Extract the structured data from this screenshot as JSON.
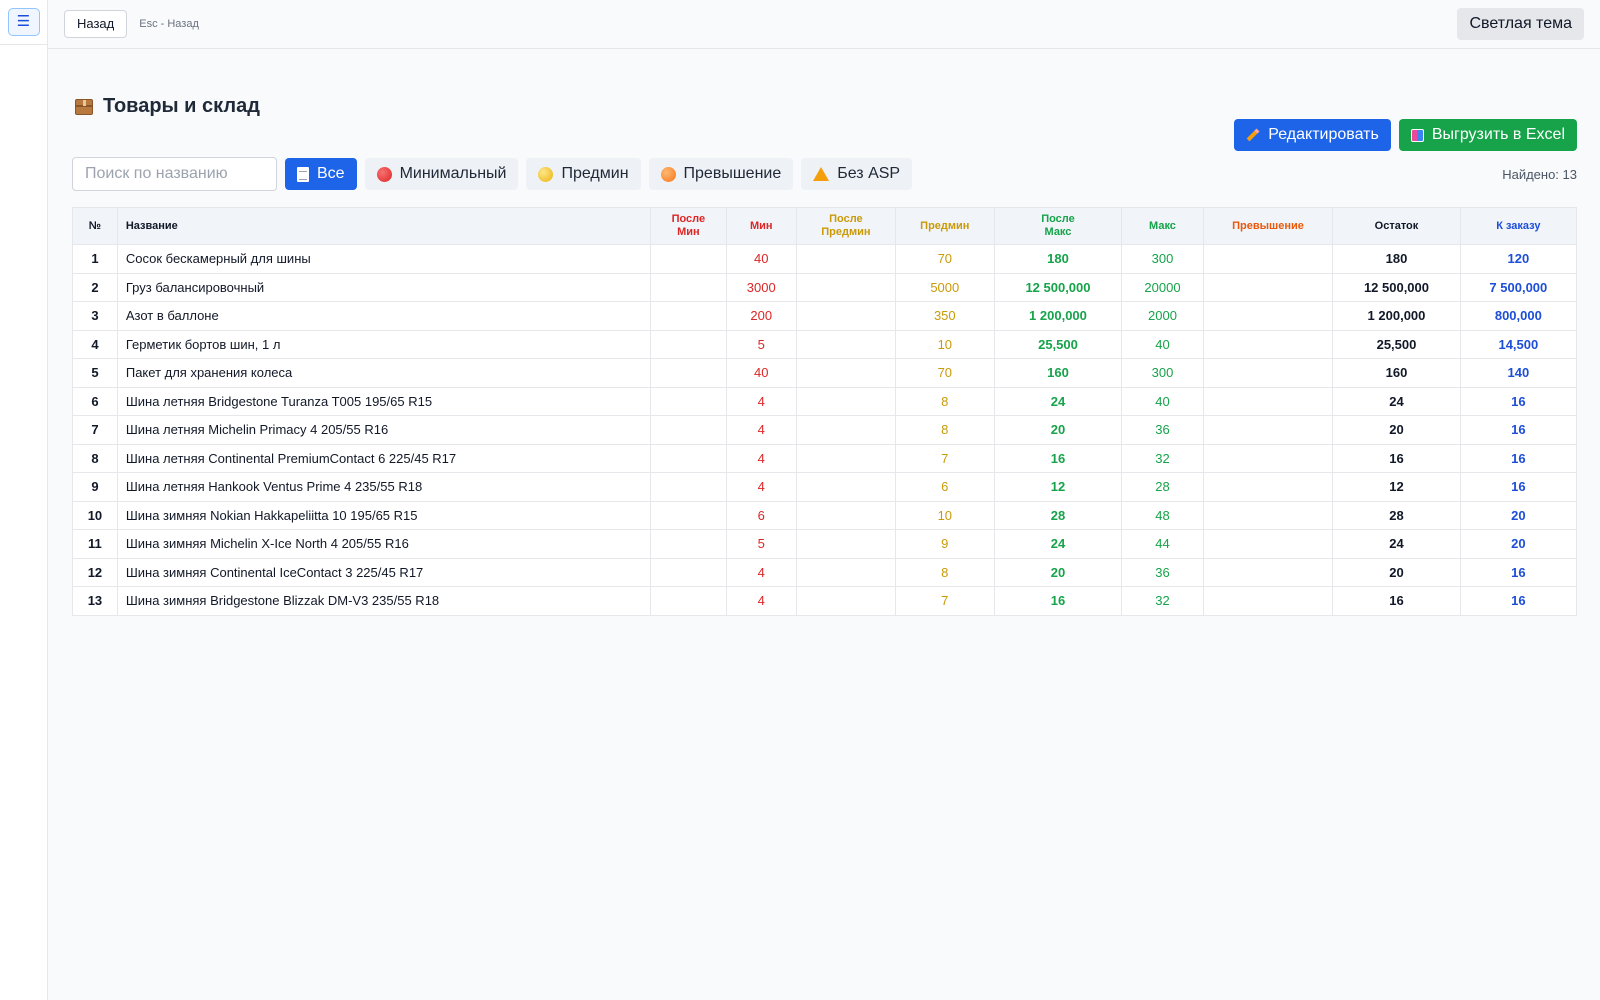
{
  "topbar": {
    "menu_icon": "☰",
    "back_label": "Назад",
    "esc_hint": "Esc - Назад",
    "theme_label": "Светлая тема"
  },
  "page": {
    "title": "Товары и склад",
    "edit_label": "Редактировать",
    "export_label": "Выгрузить в Excel"
  },
  "filters": {
    "search_placeholder": "Поиск по названию",
    "search_value": "",
    "all_label": "Все",
    "min_label": "Минимальный",
    "premin_label": "Предмин",
    "excess_label": "Превышение",
    "noasp_label": "Без ASP",
    "found_text": "Найдено: 13"
  },
  "colors": {
    "min": "#dc2626",
    "premin": "#ca9a08",
    "max": "#16a34a",
    "excess": "#ea580c",
    "order": "#1d4ed8",
    "primary": "#1d64e8",
    "excel": "#16a34a"
  },
  "table": {
    "headers": {
      "num": "№",
      "name": "Название",
      "after_min_1": "После",
      "after_min_2": "Мин",
      "min": "Мин",
      "after_premin_1": "После",
      "after_premin_2": "Предмин",
      "premin": "Предмин",
      "after_max_1": "После",
      "after_max_2": "Макс",
      "max": "Макс",
      "excess": "Превышение",
      "stock": "Остаток",
      "order": "К заказу"
    },
    "rows": [
      {
        "num": "1",
        "name": "Сосок бескамерный для шины",
        "after_min": "",
        "min": "40",
        "after_premin": "",
        "premin": "70",
        "after_max": "180",
        "max": "300",
        "excess": "",
        "stock": "180",
        "order": "120"
      },
      {
        "num": "2",
        "name": "Груз балансировочный",
        "after_min": "",
        "min": "3000",
        "after_premin": "",
        "premin": "5000",
        "after_max": "12 500,000",
        "max": "20000",
        "excess": "",
        "stock": "12 500,000",
        "order": "7 500,000"
      },
      {
        "num": "3",
        "name": "Азот в баллоне",
        "after_min": "",
        "min": "200",
        "after_premin": "",
        "premin": "350",
        "after_max": "1 200,000",
        "max": "2000",
        "excess": "",
        "stock": "1 200,000",
        "order": "800,000"
      },
      {
        "num": "4",
        "name": "Герметик бортов шин, 1 л",
        "after_min": "",
        "min": "5",
        "after_premin": "",
        "premin": "10",
        "after_max": "25,500",
        "max": "40",
        "excess": "",
        "stock": "25,500",
        "order": "14,500"
      },
      {
        "num": "5",
        "name": "Пакет для хранения колеса",
        "after_min": "",
        "min": "40",
        "after_premin": "",
        "premin": "70",
        "after_max": "160",
        "max": "300",
        "excess": "",
        "stock": "160",
        "order": "140"
      },
      {
        "num": "6",
        "name": "Шина летняя Bridgestone Turanza T005 195/65 R15",
        "after_min": "",
        "min": "4",
        "after_premin": "",
        "premin": "8",
        "after_max": "24",
        "max": "40",
        "excess": "",
        "stock": "24",
        "order": "16"
      },
      {
        "num": "7",
        "name": "Шина летняя Michelin Primacy 4 205/55 R16",
        "after_min": "",
        "min": "4",
        "after_premin": "",
        "premin": "8",
        "after_max": "20",
        "max": "36",
        "excess": "",
        "stock": "20",
        "order": "16"
      },
      {
        "num": "8",
        "name": "Шина летняя Continental PremiumContact 6 225/45 R17",
        "after_min": "",
        "min": "4",
        "after_premin": "",
        "premin": "7",
        "after_max": "16",
        "max": "32",
        "excess": "",
        "stock": "16",
        "order": "16"
      },
      {
        "num": "9",
        "name": "Шина летняя Hankook Ventus Prime 4 235/55 R18",
        "after_min": "",
        "min": "4",
        "after_premin": "",
        "premin": "6",
        "after_max": "12",
        "max": "28",
        "excess": "",
        "stock": "12",
        "order": "16"
      },
      {
        "num": "10",
        "name": "Шина зимняя Nokian Hakkapeliitta 10 195/65 R15",
        "after_min": "",
        "min": "6",
        "after_premin": "",
        "premin": "10",
        "after_max": "28",
        "max": "48",
        "excess": "",
        "stock": "28",
        "order": "20"
      },
      {
        "num": "11",
        "name": "Шина зимняя Michelin X-Ice North 4 205/55 R16",
        "after_min": "",
        "min": "5",
        "after_premin": "",
        "premin": "9",
        "after_max": "24",
        "max": "44",
        "excess": "",
        "stock": "24",
        "order": "20"
      },
      {
        "num": "12",
        "name": "Шина зимняя Continental IceContact 3 225/45 R17",
        "after_min": "",
        "min": "4",
        "after_premin": "",
        "premin": "8",
        "after_max": "20",
        "max": "36",
        "excess": "",
        "stock": "20",
        "order": "16"
      },
      {
        "num": "13",
        "name": "Шина зимняя Bridgestone Blizzak DM-V3 235/55 R18",
        "after_min": "",
        "min": "4",
        "after_premin": "",
        "premin": "7",
        "after_max": "16",
        "max": "32",
        "excess": "",
        "stock": "16",
        "order": "16"
      }
    ]
  }
}
